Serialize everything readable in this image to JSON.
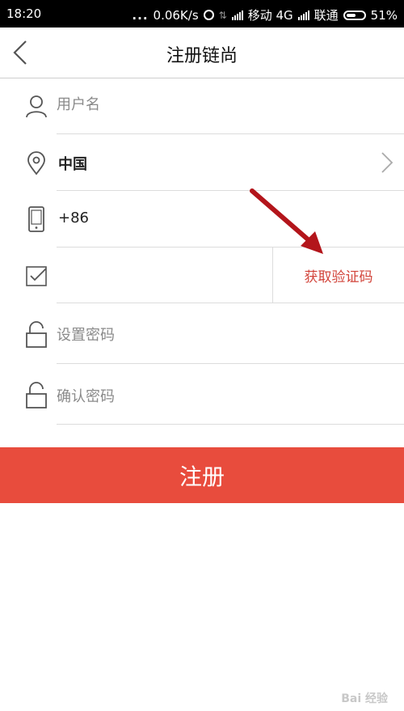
{
  "status_bar": {
    "time": "18:20",
    "dots": "...",
    "speed": "0.06K/s",
    "carrier1": "移动 4G",
    "carrier2": "联通",
    "battery": "51%"
  },
  "header": {
    "title": "注册链尚"
  },
  "form": {
    "username": {
      "placeholder": "用户名",
      "value": ""
    },
    "country": {
      "value": "中国"
    },
    "phone": {
      "prefix": "+86",
      "value": ""
    },
    "verify": {
      "value": "",
      "button_label": "获取验证码"
    },
    "password": {
      "placeholder": "设置密码",
      "value": ""
    },
    "confirm": {
      "placeholder": "确认密码",
      "value": ""
    }
  },
  "register_button": {
    "label": "注册"
  },
  "colors": {
    "accent": "#e84c3d",
    "code_text": "#d2443a",
    "annotation_arrow": "#b3151b"
  },
  "icons": {
    "back": "chevron-left-icon",
    "user": "user-icon",
    "location": "location-pin-icon",
    "phone": "smartphone-icon",
    "verify": "checkbox-icon",
    "lock": "lock-icon",
    "chevron": "chevron-right-icon"
  },
  "watermark": "Bai 经验"
}
